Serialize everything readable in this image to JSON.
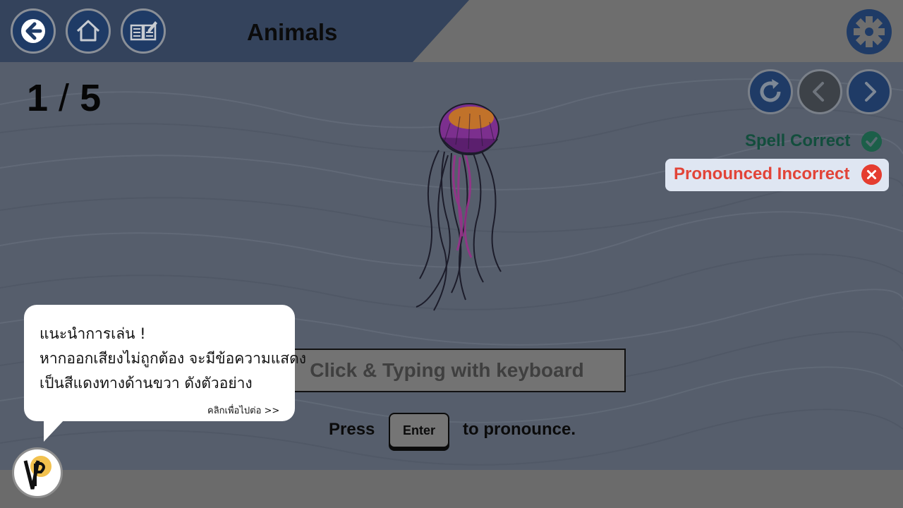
{
  "header": {
    "title": "Animals",
    "buttons": [
      {
        "name": "back",
        "icon": "arrow-left-icon"
      },
      {
        "name": "home",
        "icon": "home-icon"
      },
      {
        "name": "book",
        "icon": "book-edit-icon"
      }
    ],
    "settings_icon": "gear-icon"
  },
  "progress": {
    "current": "1",
    "separator": "/",
    "total": "5"
  },
  "controls": {
    "replay_icon": "replay-icon",
    "prev_icon": "chevron-left-icon",
    "next_icon": "chevron-right-icon"
  },
  "feedback": {
    "spell_label": "Spell Correct",
    "spell_status": "correct",
    "pronounce_label": "Pronounced Incorrect",
    "pronounce_status": "incorrect"
  },
  "card": {
    "image_icon": "jellyfish-illustration"
  },
  "input": {
    "placeholder": "Click & Typing with keyboard"
  },
  "instructions": {
    "press": "Press",
    "key": "Enter",
    "suffix": "to pronounce."
  },
  "tip": {
    "lines": [
      "แนะนำการเล่น !",
      "หากออกเสียงไม่ถูกต้อง จะมีข้อความแสดง",
      "เป็นสีแดงทางด้านขวา ดังตัวอย่าง"
    ],
    "continue": "คลิกเพื่อไปต่อ >>"
  },
  "colors": {
    "header_panel": "#34435c",
    "button_fill": "#1f3b66",
    "correct": "#1c5f49",
    "incorrect": "#e53d30"
  }
}
